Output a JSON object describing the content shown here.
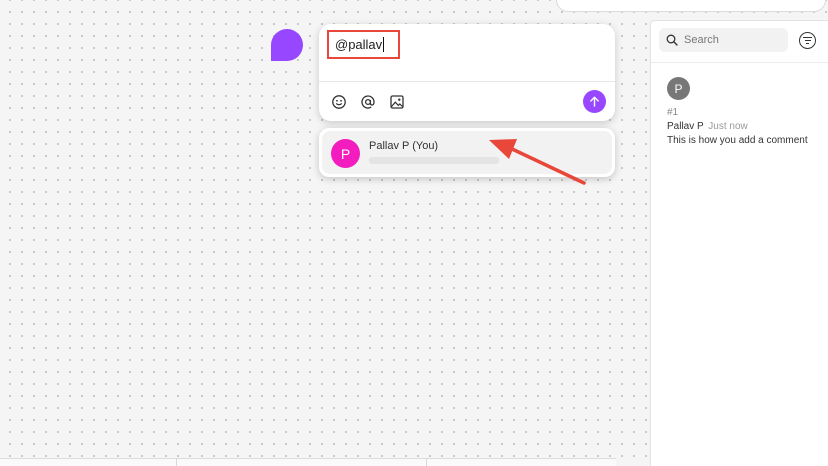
{
  "colors": {
    "accent": "#9747ff",
    "highlight": "#e8473a",
    "mention_avatar": "#f21cbf",
    "thread_avatar": "#777777"
  },
  "composer": {
    "input_value": "@pallav",
    "tools": [
      "emoji-icon",
      "mention-icon",
      "image-icon"
    ],
    "send_icon": "arrow-up-icon"
  },
  "mention_dropdown": {
    "items": [
      {
        "avatar_initial": "P",
        "name": "Pallav P (You)"
      }
    ]
  },
  "sidebar": {
    "search": {
      "placeholder": "Search",
      "icon": "search-icon"
    },
    "filter_icon": "filter-icon",
    "comment": {
      "avatar_initial": "P",
      "number": "#1",
      "author": "Pallav P",
      "time": "Just now",
      "body": "This is how you add a comment"
    }
  }
}
